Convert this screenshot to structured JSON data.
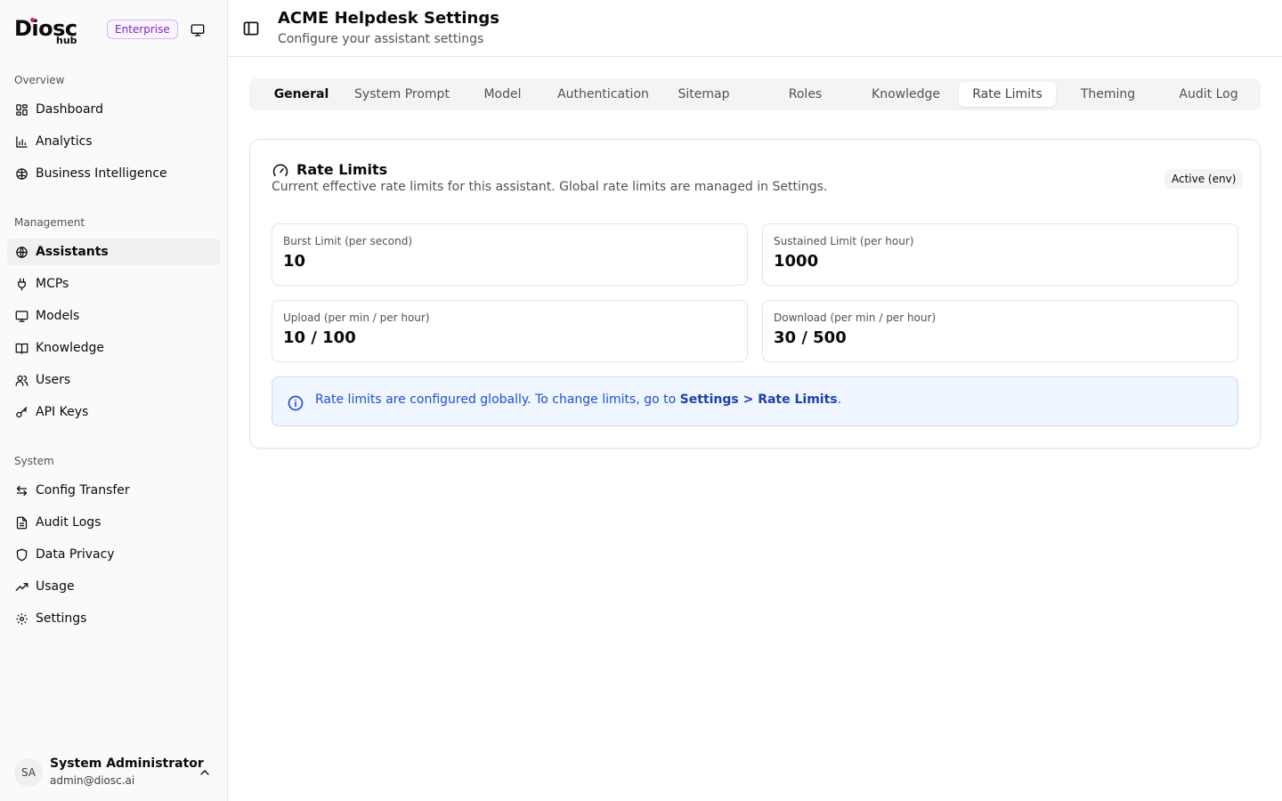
{
  "brand": {
    "logo_main": "Diosc",
    "logo_sub": "hub",
    "plan_badge": "Enterprise"
  },
  "sidebar": {
    "sections": [
      {
        "label": "Overview",
        "items": [
          {
            "label": "Dashboard",
            "icon": "dashboard-icon"
          },
          {
            "label": "Analytics",
            "icon": "bar-chart-icon"
          },
          {
            "label": "Business Intelligence",
            "icon": "brain-icon"
          }
        ]
      },
      {
        "label": "Management",
        "items": [
          {
            "label": "Assistants",
            "icon": "globe-icon",
            "active": true
          },
          {
            "label": "MCPs",
            "icon": "plug-icon"
          },
          {
            "label": "Models",
            "icon": "monitor-icon"
          },
          {
            "label": "Knowledge",
            "icon": "book-icon"
          },
          {
            "label": "Users",
            "icon": "users-icon"
          },
          {
            "label": "API Keys",
            "icon": "key-icon"
          }
        ]
      },
      {
        "label": "System",
        "items": [
          {
            "label": "Config Transfer",
            "icon": "transfer-icon"
          },
          {
            "label": "Audit Logs",
            "icon": "file-text-icon"
          },
          {
            "label": "Data Privacy",
            "icon": "shield-icon"
          },
          {
            "label": "Usage",
            "icon": "trending-up-icon"
          },
          {
            "label": "Settings",
            "icon": "gear-icon"
          }
        ]
      }
    ]
  },
  "user": {
    "initials": "SA",
    "name": "System Administrator",
    "email": "admin@diosc.ai"
  },
  "header": {
    "title": "ACME Helpdesk Settings",
    "subtitle": "Configure your assistant settings"
  },
  "tabs": [
    "General",
    "System Prompt",
    "Model",
    "Authentication",
    "Sitemap",
    "Roles",
    "Knowledge",
    "Rate Limits",
    "Theming",
    "Audit Log"
  ],
  "active_tab": "Rate Limits",
  "card": {
    "title": "Rate Limits",
    "description": "Current effective rate limits for this assistant. Global rate limits are managed in Settings.",
    "status_badge": "Active (env)",
    "stats": [
      {
        "label": "Burst Limit (per second)",
        "value": "10"
      },
      {
        "label": "Sustained Limit (per hour)",
        "value": "1000"
      },
      {
        "label": "Upload (per min / per hour)",
        "value": "10 / 100"
      },
      {
        "label": "Download (per min / per hour)",
        "value": "30 / 500"
      }
    ],
    "info": {
      "text": "Rate limits are configured globally. To change limits, go to ",
      "link": "Settings > Rate Limits",
      "suffix": "."
    }
  },
  "colors": {
    "accent_blue": "#1d4ed8",
    "enterprise_purple": "#7e22ce",
    "info_bg": "#eff6ff"
  }
}
